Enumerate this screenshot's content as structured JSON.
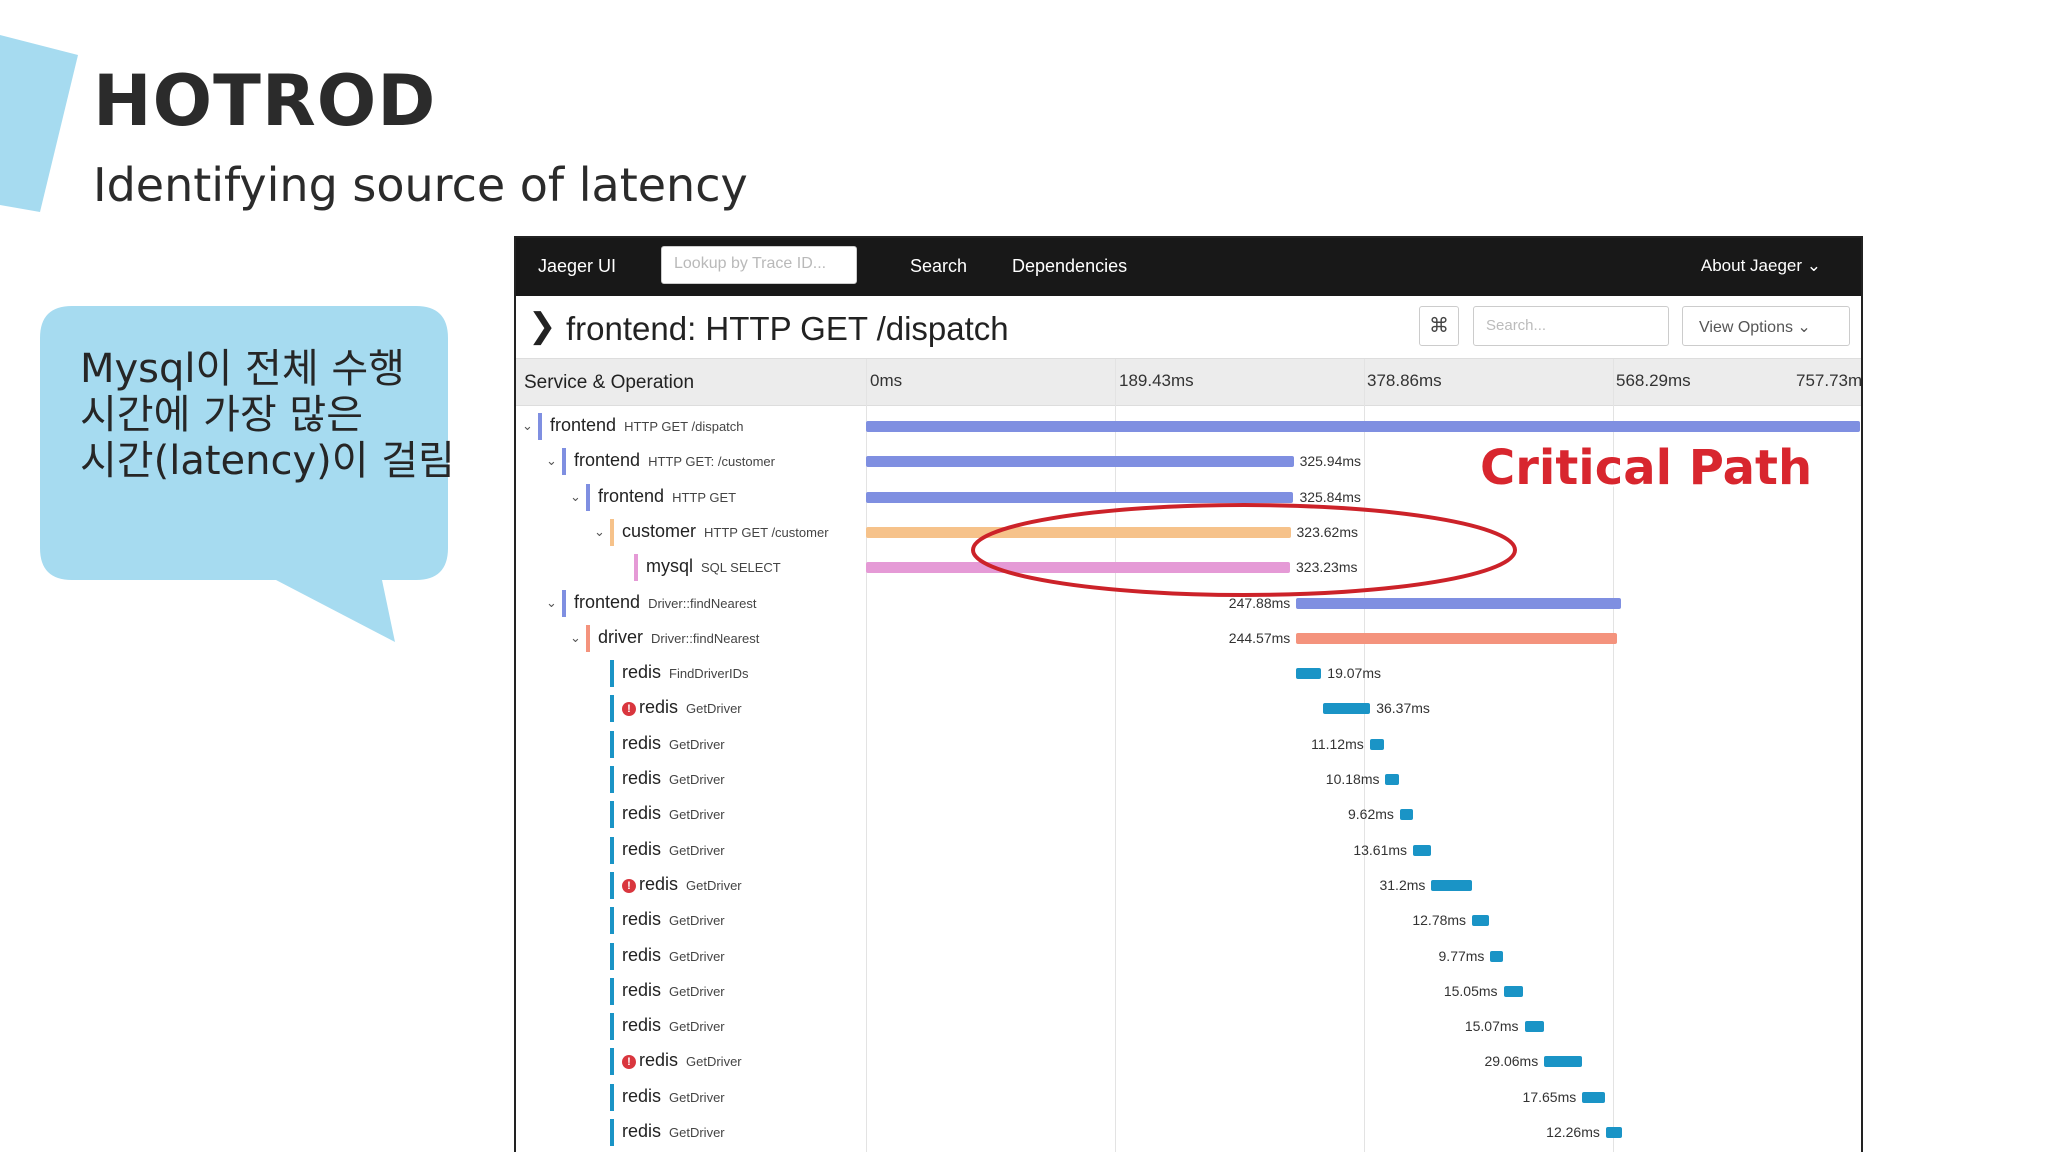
{
  "slide": {
    "title": "HOTROD",
    "subtitle": "Identifying source of  latency",
    "callout": "Mysql이 전체 수행\n시간에 가장 많은\n시간(latency)이 걸림",
    "annotation": "Critical Path",
    "colors": {
      "accent": "#a6dbf0",
      "annotation": "#d8262e",
      "ellipse": "#cc2229"
    }
  },
  "jaeger": {
    "brand": "Jaeger UI",
    "lookup_placeholder": "Lookup by Trace ID...",
    "nav": [
      "Search",
      "Dependencies"
    ],
    "about": "About Jaeger ⌄",
    "trace_title": "frontend: HTTP GET /dispatch",
    "collapse_icon": "chevron-right-icon",
    "keyboard_icon": "⌘",
    "search_placeholder": "Search...",
    "view_options": "View Options ⌄",
    "table_header": "Service & Operation",
    "ticks": [
      "0ms",
      "189.43ms",
      "378.86ms",
      "568.29ms",
      "757.73ms"
    ],
    "total_ms": 757.73,
    "spans": [
      {
        "service": "frontend",
        "op": "HTTP GET /dispatch",
        "depth": 0,
        "start": 0,
        "duration": 757.73,
        "dur_label": "",
        "color": "#7f8fe1",
        "caret": true,
        "error": false
      },
      {
        "service": "frontend",
        "op": "HTTP GET: /customer",
        "depth": 1,
        "start": 0,
        "duration": 325.94,
        "dur_label": "325.94ms",
        "color": "#7f8fe1",
        "caret": true,
        "error": false
      },
      {
        "service": "frontend",
        "op": "HTTP GET",
        "depth": 2,
        "start": 0,
        "duration": 325.84,
        "dur_label": "325.84ms",
        "color": "#7f8fe1",
        "caret": true,
        "error": false
      },
      {
        "service": "customer",
        "op": "HTTP GET /customer",
        "depth": 3,
        "start": 0,
        "duration": 323.62,
        "dur_label": "323.62ms",
        "color": "#f6c28a",
        "caret": true,
        "error": false
      },
      {
        "service": "mysql",
        "op": "SQL SELECT",
        "depth": 4,
        "start": 0,
        "duration": 323.23,
        "dur_label": "323.23ms",
        "color": "#e59ad6",
        "caret": false,
        "error": false
      },
      {
        "service": "frontend",
        "op": "Driver::findNearest",
        "depth": 1,
        "start": 328,
        "duration": 247.88,
        "dur_label": "247.88ms",
        "color": "#7f8fe1",
        "caret": true,
        "error": false,
        "label_left": true
      },
      {
        "service": "driver",
        "op": "Driver::findNearest",
        "depth": 2,
        "start": 328,
        "duration": 244.57,
        "dur_label": "244.57ms",
        "color": "#f4937d",
        "caret": true,
        "error": false,
        "label_left": true
      },
      {
        "service": "redis",
        "op": "FindDriverIDs",
        "depth": 3,
        "start": 328,
        "duration": 19.07,
        "dur_label": "19.07ms",
        "color": "#1a94c6",
        "caret": false,
        "error": false
      },
      {
        "service": "redis",
        "op": "GetDriver",
        "depth": 3,
        "start": 348,
        "duration": 36.37,
        "dur_label": "36.37ms",
        "color": "#1a94c6",
        "caret": false,
        "error": true
      },
      {
        "service": "redis",
        "op": "GetDriver",
        "depth": 3,
        "start": 384,
        "duration": 11.12,
        "dur_label": "11.12ms",
        "color": "#1a94c6",
        "caret": false,
        "error": false,
        "label_left": true
      },
      {
        "service": "redis",
        "op": "GetDriver",
        "depth": 3,
        "start": 396,
        "duration": 10.18,
        "dur_label": "10.18ms",
        "color": "#1a94c6",
        "caret": false,
        "error": false,
        "label_left": true
      },
      {
        "service": "redis",
        "op": "GetDriver",
        "depth": 3,
        "start": 407,
        "duration": 9.62,
        "dur_label": "9.62ms",
        "color": "#1a94c6",
        "caret": false,
        "error": false,
        "label_left": true
      },
      {
        "service": "redis",
        "op": "GetDriver",
        "depth": 3,
        "start": 417,
        "duration": 13.61,
        "dur_label": "13.61ms",
        "color": "#1a94c6",
        "caret": false,
        "error": false,
        "label_left": true
      },
      {
        "service": "redis",
        "op": "GetDriver",
        "depth": 3,
        "start": 431,
        "duration": 31.2,
        "dur_label": "31.2ms",
        "color": "#1a94c6",
        "caret": false,
        "error": true,
        "label_left": true
      },
      {
        "service": "redis",
        "op": "GetDriver",
        "depth": 3,
        "start": 462,
        "duration": 12.78,
        "dur_label": "12.78ms",
        "color": "#1a94c6",
        "caret": false,
        "error": false,
        "label_left": true
      },
      {
        "service": "redis",
        "op": "GetDriver",
        "depth": 3,
        "start": 476,
        "duration": 9.77,
        "dur_label": "9.77ms",
        "color": "#1a94c6",
        "caret": false,
        "error": false,
        "label_left": true
      },
      {
        "service": "redis",
        "op": "GetDriver",
        "depth": 3,
        "start": 486,
        "duration": 15.05,
        "dur_label": "15.05ms",
        "color": "#1a94c6",
        "caret": false,
        "error": false,
        "label_left": true
      },
      {
        "service": "redis",
        "op": "GetDriver",
        "depth": 3,
        "start": 502,
        "duration": 15.07,
        "dur_label": "15.07ms",
        "color": "#1a94c6",
        "caret": false,
        "error": false,
        "label_left": true
      },
      {
        "service": "redis",
        "op": "GetDriver",
        "depth": 3,
        "start": 517,
        "duration": 29.06,
        "dur_label": "29.06ms",
        "color": "#1a94c6",
        "caret": false,
        "error": true,
        "label_left": true
      },
      {
        "service": "redis",
        "op": "GetDriver",
        "depth": 3,
        "start": 546,
        "duration": 17.65,
        "dur_label": "17.65ms",
        "color": "#1a94c6",
        "caret": false,
        "error": false,
        "label_left": true
      },
      {
        "service": "redis",
        "op": "GetDriver",
        "depth": 3,
        "start": 564,
        "duration": 12.26,
        "dur_label": "12.26ms",
        "color": "#1a94c6",
        "caret": false,
        "error": false,
        "label_left": true
      }
    ]
  }
}
